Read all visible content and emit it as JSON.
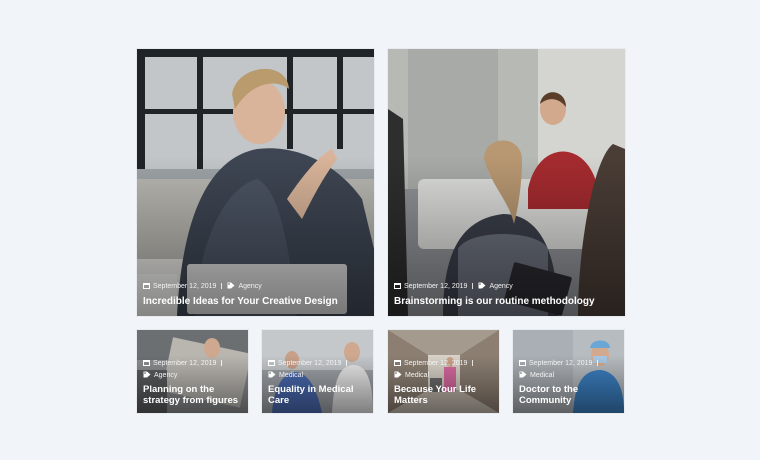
{
  "posts": [
    {
      "date": "September 12, 2019",
      "category": "Agency",
      "title": "Incredible Ideas for Your Creative Design"
    },
    {
      "date": "September 12, 2019",
      "category": "Agency",
      "title": "Brainstorming is our routine methodology"
    },
    {
      "date": "September 12, 2019",
      "category": "Agency",
      "title": "Planning on the strategy from figures"
    },
    {
      "date": "September 12, 2019",
      "category": "Medical",
      "title": "Equality in Medical Care"
    },
    {
      "date": "September 12, 2019",
      "category": "Medical",
      "title": "Because Your Life Matters"
    },
    {
      "date": "September 12, 2019",
      "category": "Medical",
      "title": "Doctor to the Community"
    }
  ],
  "icons": {
    "date": "calendar-icon",
    "category": "tag-icon"
  },
  "colors": {
    "page_background": "#f1f4f8",
    "text": "#ffffff"
  }
}
